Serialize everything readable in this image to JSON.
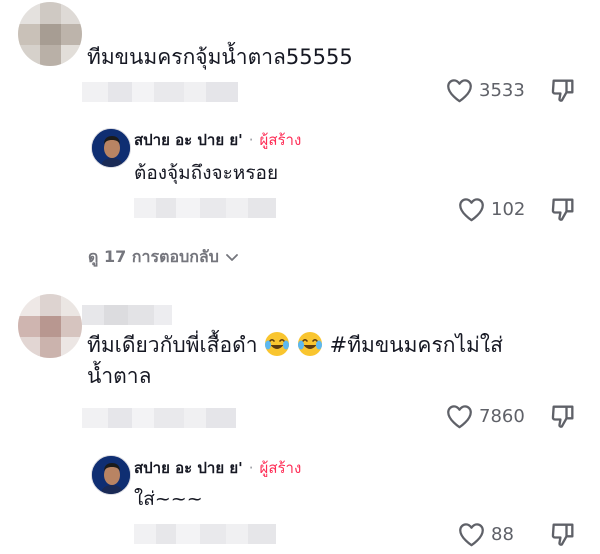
{
  "comments": [
    {
      "text": "ทีมขนมครกจุ้มน้ำตาล55555",
      "likes": "3533",
      "reply": {
        "author": "สปาย อะ ปาย ย'",
        "separator": "·",
        "badge": "ผู้สร้าง",
        "text": "ต้องจุ้มถึงจะหรอย",
        "likes": "102"
      },
      "view_replies": "ดู 17 การตอบกลับ"
    },
    {
      "text_line1": "ทีมเดียวกับพี่เสื้อดำ",
      "hashtag": "#ทีมขนมครกไม่ใส่",
      "text_line2": "น้ำตาล",
      "emoji": "face-with-tears-of-joy",
      "likes": "7860",
      "reply": {
        "author": "สปาย อะ ปาย ย'",
        "separator": "·",
        "badge": "ผู้สร้าง",
        "text": "ใส่~~~",
        "likes": "88"
      }
    }
  ],
  "colors": {
    "creator_badge": "#fe2c55",
    "secondary_text": "#75767d",
    "icon": "#5f6168"
  },
  "icons": {
    "like": "heart-outline-icon",
    "dislike": "thumbs-down-icon",
    "expand": "chevron-down-icon"
  }
}
